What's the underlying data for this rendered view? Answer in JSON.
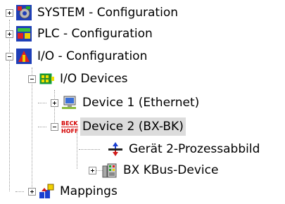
{
  "tree": {
    "items": [
      {
        "label": "SYSTEM - Configuration",
        "icon": "system-config-icon",
        "expander": "collapsed"
      },
      {
        "label": "PLC - Configuration",
        "icon": "plc-config-icon",
        "expander": "collapsed"
      },
      {
        "label": "I/O - Configuration",
        "icon": "io-config-icon",
        "expander": "expanded"
      },
      {
        "label": "I/O Devices",
        "icon": "io-devices-icon",
        "expander": "expanded"
      },
      {
        "label": "Device 1 (Ethernet)",
        "icon": "ethernet-device-icon",
        "expander": "collapsed"
      },
      {
        "label": "Device 2 (BX-BK)",
        "icon": "beckhoff-device-icon",
        "expander": "expanded",
        "selected": true
      },
      {
        "label": "Gerät 2-Prozessabbild",
        "icon": "process-image-icon",
        "expander": "none"
      },
      {
        "label": "BX KBus-Device",
        "icon": "kbus-device-icon",
        "expander": "collapsed"
      },
      {
        "label": "Mappings",
        "icon": "mappings-icon",
        "expander": "collapsed"
      }
    ],
    "beckhoff_logo_text": [
      "BECK",
      "HOFF"
    ]
  }
}
